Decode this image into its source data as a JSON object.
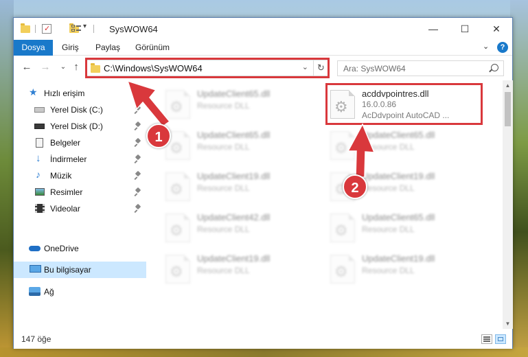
{
  "window": {
    "title": "SysWOW64",
    "minimize_glyph": "—",
    "maximize_glyph": "☐",
    "close_glyph": "✕"
  },
  "ribbon": {
    "tabs": [
      "Dosya",
      "Giriş",
      "Paylaş",
      "Görünüm"
    ],
    "expand_glyph": "⌄",
    "help_glyph": "?"
  },
  "nav": {
    "back_glyph": "←",
    "forward_glyph": "→",
    "recent_glyph": "⌄",
    "up_glyph": "↑",
    "address": "C:\\Windows\\SysWOW64",
    "address_dropdown_glyph": "⌄",
    "refresh_glyph": "↻",
    "search_placeholder": "Ara: SysWOW64"
  },
  "sidebar": {
    "items": [
      {
        "label": "Hızlı erişim",
        "icon": "star-icon",
        "pinned": false
      },
      {
        "label": "Yerel Disk (C:)",
        "icon": "drive-icon",
        "pinned": true
      },
      {
        "label": "Yerel Disk (D:)",
        "icon": "drive-icon",
        "pinned": true
      },
      {
        "label": "Belgeler",
        "icon": "document-icon",
        "pinned": true
      },
      {
        "label": "İndirmeler",
        "icon": "download-icon",
        "pinned": true
      },
      {
        "label": "Müzik",
        "icon": "music-icon",
        "pinned": true
      },
      {
        "label": "Resimler",
        "icon": "picture-icon",
        "pinned": true
      },
      {
        "label": "Videolar",
        "icon": "video-icon",
        "pinned": true
      },
      {
        "label": "OneDrive",
        "icon": "cloud-icon",
        "pinned": false
      },
      {
        "label": "Bu bilgisayar",
        "icon": "computer-icon",
        "pinned": false,
        "selected": true
      },
      {
        "label": "Ağ",
        "icon": "network-icon",
        "pinned": false
      }
    ]
  },
  "files": [
    {
      "name": "UpdateClient65.dll",
      "type": "Resource DLL",
      "blurred": true
    },
    {
      "name": "acddvpointres.dll",
      "type": "16.0.0.86",
      "desc": "AcDdvpoint AutoCAD ...",
      "blurred": false
    },
    {
      "name": "UpdateClient65.dll",
      "type": "Resource DLL",
      "blurred": true
    },
    {
      "name": "UpdateClient65.dll",
      "type": "Resource DLL",
      "blurred": true
    },
    {
      "name": "UpdateClient19.dll",
      "type": "Resource DLL",
      "blurred": true
    },
    {
      "name": "UpdateClient19.dll",
      "type": "Resource DLL",
      "blurred": true
    },
    {
      "name": "UpdateClient42.dll",
      "type": "Resource DLL",
      "blurred": true
    },
    {
      "name": "UpdateClient65.dll",
      "type": "Resource DLL",
      "blurred": true
    },
    {
      "name": "UpdateClient19.dll",
      "type": "Resource DLL",
      "blurred": true
    },
    {
      "name": "UpdateClient19.dll",
      "type": "Resource DLL",
      "blurred": true
    }
  ],
  "scrollbar": {
    "up_glyph": "▲",
    "down_glyph": "▼"
  },
  "status": {
    "item_count": "147 öğe"
  },
  "callouts": {
    "one": "1",
    "two": "2"
  },
  "colors": {
    "accent": "#1979ca",
    "highlight": "#d9383c",
    "selected_bg": "#cce8ff"
  }
}
